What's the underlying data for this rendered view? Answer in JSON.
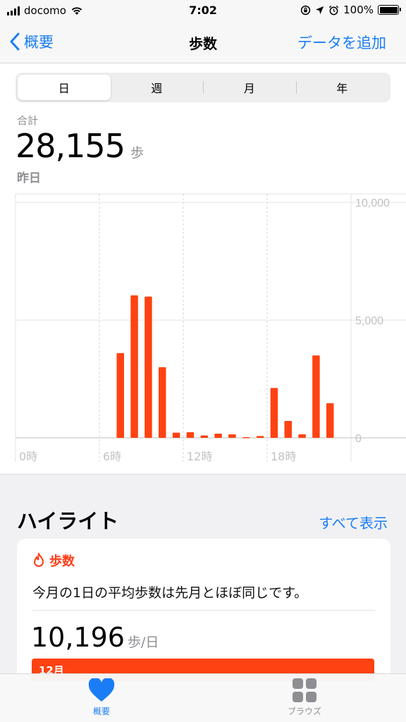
{
  "status_bar": {
    "carrier": "docomo",
    "time": "7:02",
    "battery": "100%",
    "signal_bars": 4
  },
  "nav": {
    "back_label": "概要",
    "title": "歩数",
    "add_label": "データを追加"
  },
  "segments": [
    {
      "label": "日",
      "active": true
    },
    {
      "label": "週",
      "active": false
    },
    {
      "label": "月",
      "active": false
    },
    {
      "label": "年",
      "active": false
    }
  ],
  "summary": {
    "total_label": "合計",
    "value": "28,155",
    "unit": "歩",
    "date_label": "昨日"
  },
  "chart_data": {
    "type": "bar",
    "x_tick_labels": [
      "0時",
      "6時",
      "12時",
      "18時"
    ],
    "y_tick_labels": [
      "10,000",
      "5,000",
      "0"
    ],
    "ylim": [
      0,
      10000
    ],
    "hours": [
      0,
      1,
      2,
      3,
      4,
      5,
      6,
      7,
      8,
      9,
      10,
      11,
      12,
      13,
      14,
      15,
      16,
      17,
      18,
      19,
      20,
      21,
      22,
      23
    ],
    "values": [
      0,
      0,
      0,
      0,
      0,
      0,
      0,
      3600,
      6050,
      6000,
      3000,
      220,
      240,
      100,
      180,
      150,
      30,
      80,
      2120,
      720,
      150,
      3500,
      1470,
      0
    ],
    "bar_color": "#ff4212",
    "grid": true
  },
  "highlights": {
    "title": "ハイライト",
    "show_all": "すべて表示",
    "card": {
      "category": "歩数",
      "text": "今月の1日の平均歩数は先月とほぼ同じです。",
      "value": "10,196",
      "unit": "歩/日",
      "bar_label": "12月"
    }
  },
  "tabbar": {
    "summary_label": "概要",
    "browse_label": "ブラウズ"
  },
  "colors": {
    "accent": "#1a7df5",
    "bar": "#ff4212",
    "secondary_text": "#8e8e93"
  }
}
